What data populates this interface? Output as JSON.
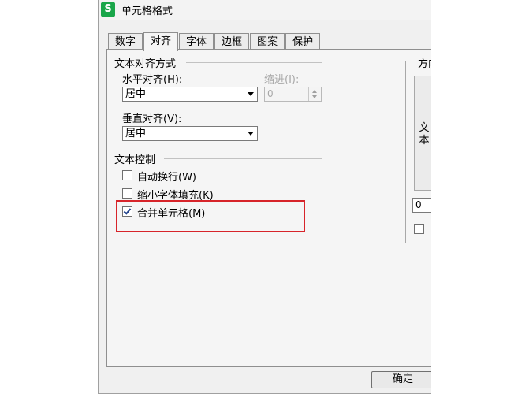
{
  "window": {
    "app_icon_letter": "S",
    "title": "单元格格式"
  },
  "tabs": [
    {
      "label": "数字"
    },
    {
      "label": "对齐"
    },
    {
      "label": "字体"
    },
    {
      "label": "边框"
    },
    {
      "label": "图案"
    },
    {
      "label": "保护"
    }
  ],
  "text_alignment": {
    "group_title": "文本对齐方式",
    "horizontal_label": "水平对齐(H):",
    "horizontal_value": "居中",
    "indent_label": "缩进(I):",
    "indent_value": "0",
    "vertical_label": "垂直对齐(V):",
    "vertical_value": "居中"
  },
  "text_control": {
    "group_title": "文本控制",
    "wrap_text": {
      "label": "自动换行(W)",
      "checked": false
    },
    "shrink_to_fit": {
      "label": "缩小字体填充(K)",
      "checked": false
    },
    "merge_cells": {
      "label": "合并单元格(M)",
      "checked": true
    }
  },
  "orientation": {
    "group_title": "方向",
    "vertical_text": "文本",
    "degrees_value": "0"
  },
  "footer": {
    "ok_label": "确定"
  },
  "colors": {
    "highlight": "#d7242a",
    "app_icon": "#1aa64a"
  }
}
